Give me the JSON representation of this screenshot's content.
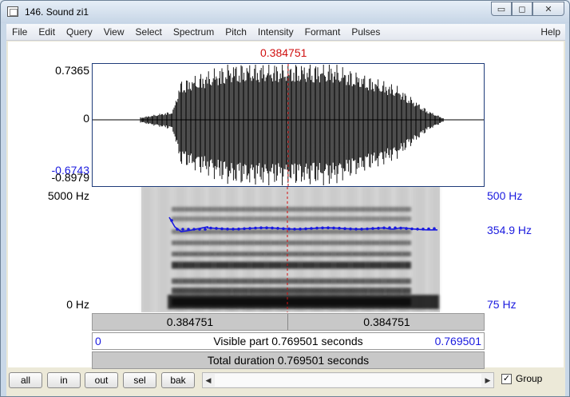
{
  "window": {
    "title": "146. Sound zi1",
    "minimize_icon": "minimize-icon",
    "maximize_icon": "maximize-icon",
    "close_icon": "close-icon",
    "min_glyph": "▭",
    "max_glyph": "◻",
    "close_glyph": "✕"
  },
  "menu": {
    "items": [
      "File",
      "Edit",
      "Query",
      "View",
      "Select",
      "Spectrum",
      "Pitch",
      "Intensity",
      "Formant",
      "Pulses"
    ],
    "help": "Help"
  },
  "cursor": {
    "time": "0.384751"
  },
  "waveform": {
    "max_label": "0.7365",
    "zero_label": "0",
    "min_label": "-0.8979",
    "blue_label": "-0.6743"
  },
  "spectrogram": {
    "top_label": "5000 Hz",
    "bottom_label": "0 Hz"
  },
  "pitch": {
    "top_label": "500 Hz",
    "current_label": "354.9 Hz",
    "bottom_label": "75 Hz"
  },
  "bars": {
    "left_time": "0.384751",
    "right_time": "0.384751",
    "visible_part": "Visible part 0.769501 seconds",
    "start": "0",
    "end": "0.769501",
    "total_duration": "Total duration 0.769501 seconds"
  },
  "buttons": {
    "all": "all",
    "in": "in",
    "out": "out",
    "sel": "sel",
    "bak": "bak"
  },
  "scrollbar": {
    "left_arrow": "◀",
    "right_arrow": "▶"
  },
  "group": {
    "label": "Group",
    "checked": "✓"
  }
}
